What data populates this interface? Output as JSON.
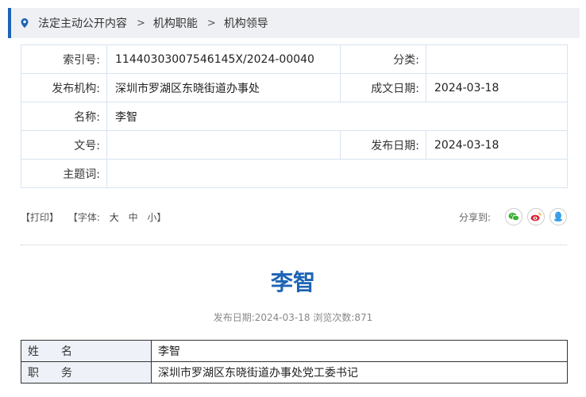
{
  "breadcrumb": {
    "items": [
      "法定主动公开内容",
      "机构职能",
      "机构领导"
    ],
    "separator": ">"
  },
  "meta": {
    "index_label": "索引号:",
    "index_value": "11440303007546145X/2024-00040",
    "category_label": "分类:",
    "category_value": "",
    "publisher_label": "发布机构:",
    "publisher_value": "深圳市罗湖区东晓街道办事处",
    "created_label": "成文日期:",
    "created_value": "2024-03-18",
    "name_label": "名称:",
    "name_value": "李智",
    "docno_label": "文号:",
    "docno_value": "",
    "published_label": "发布日期:",
    "published_value": "2024-03-18",
    "keywords_label": "主题词:",
    "keywords_value": ""
  },
  "toolbar": {
    "print": "【打印】",
    "font_label": "【字体:",
    "font_large": "大",
    "font_medium": "中",
    "font_small": "小】",
    "share_label": "分享到:",
    "share_icons": [
      "wechat-icon",
      "weibo-icon",
      "qq-icon"
    ]
  },
  "article": {
    "title": "李智",
    "publish_info": "发布日期:2024-03-18  浏览次数:871"
  },
  "profile": {
    "rows": [
      {
        "label": "姓　　名",
        "value": "李智"
      },
      {
        "label": "职　　务",
        "value": "深圳市罗湖区东晓街道办事处党工委书记"
      }
    ]
  },
  "colors": {
    "accent": "#1e64b4",
    "border": "#d7e4f2",
    "wechat": "#3cb034",
    "weibo": "#e6162d",
    "qq": "#3aa0e8"
  }
}
